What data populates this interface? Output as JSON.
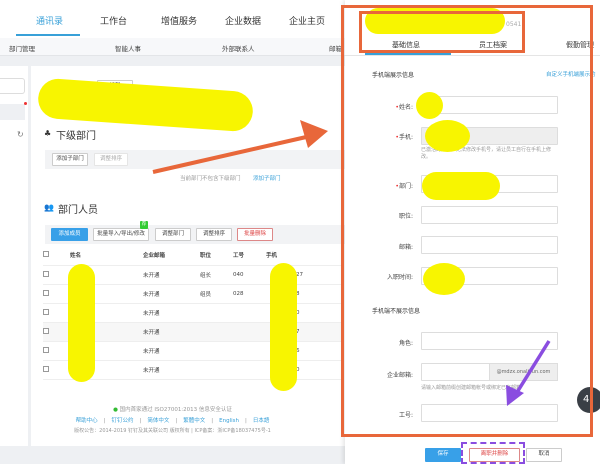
{
  "top_nav": {
    "tabs": [
      "通讯录",
      "工作台",
      "增值服务",
      "企业数据",
      "企业主页"
    ],
    "active": 0
  },
  "sub_nav": [
    "部门管理",
    "智能人事",
    "外部联系人",
    "邮箱"
  ],
  "dept": {
    "edit_label": "编辑",
    "sub_section": "下级部门",
    "add_sub": "添加子部门",
    "adjust_sort": "调整排序",
    "empty_note": "当前部门不包含下级部门",
    "add_sub_link": "添加子部门",
    "members_section": "部门人员",
    "add_member": "添加成员",
    "batch_import": "批量导入/导出/修改",
    "new_badge": "荐",
    "adjust_dept": "调整部门",
    "adjust_order": "调整排序",
    "batch_delete": "批量删除"
  },
  "table": {
    "headers": [
      "姓名",
      "企业邮箱",
      "职位",
      "工号",
      "手机"
    ],
    "rows": [
      [
        "",
        "未开通",
        "组长",
        "040",
        "2027"
      ],
      [
        "",
        "未开通",
        "组员",
        "028",
        "308"
      ],
      [
        "",
        "未开通",
        "",
        "",
        "530"
      ],
      [
        "",
        "未开通",
        "",
        "",
        "817"
      ],
      [
        "",
        "未开通",
        "",
        "",
        "816"
      ],
      [
        "",
        "未开通",
        "",
        "",
        "970"
      ]
    ]
  },
  "footer": {
    "cert": "国内首家通过 ISO27001:2013 信息安全认证",
    "links": [
      "帮助中心",
      "钉钉公约",
      "简体中文",
      "繁體中文",
      "English",
      "日本語"
    ],
    "copyright": "版权公告：2014-2019 钉钉及其关联公司 版权所有 | ICP备案：浙ICP备18037475号-1"
  },
  "panel": {
    "id_suffix": "0541",
    "tabs": [
      "基础信息",
      "员工档案",
      "假勤管理"
    ],
    "section1": "手机端展示信息",
    "custom_link": "自定义手机端展示的",
    "fields": {
      "name": "姓名",
      "phone": "手机",
      "phone_hint": "已激活的用户，无法修改手机号，请让员工自行在手机上修改。",
      "dept": "部门",
      "position": "职位",
      "email": "邮箱",
      "join_date": "入职时间"
    },
    "section2": "手机端不展示信息",
    "fields2": {
      "role": "角色",
      "corp_email": "企业邮箱",
      "email_suffix": "@mdzx.onaliyun.com",
      "email_hint": "请输入邮箱前缀创建邮箱帐号或绑定已有邮箱",
      "job_no": "工号"
    },
    "save": "保存",
    "resign": "离职并删除",
    "cancel": "取消"
  },
  "float_badge": "4"
}
